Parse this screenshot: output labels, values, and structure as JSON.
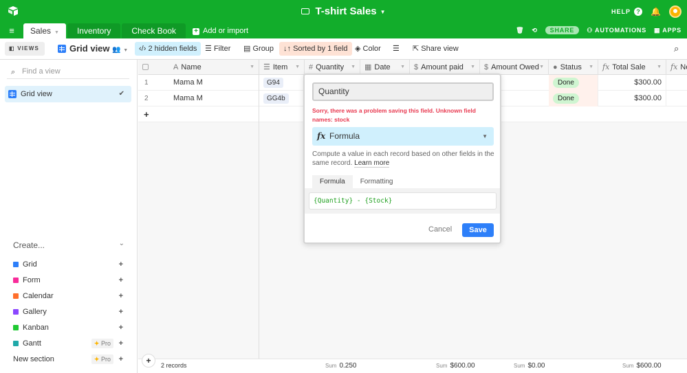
{
  "app": {
    "base_title": "T-shirt Sales",
    "help_label": "HELP",
    "tables": [
      {
        "label": "Sales",
        "active": true
      },
      {
        "label": "Inventory",
        "active": false
      },
      {
        "label": "Check Book",
        "active": false
      }
    ],
    "add_import_label": "Add or import",
    "share_label": "SHARE",
    "automations_label": "AUTOMATIONS",
    "apps_label": "APPS"
  },
  "toolbar": {
    "views_label": "VIEWS",
    "view_name": "Grid view",
    "hidden_fields": "2 hidden fields",
    "filter": "Filter",
    "group": "Group",
    "sort": "Sorted by 1 field",
    "color": "Color",
    "share_view": "Share view"
  },
  "sidebar": {
    "find_placeholder": "Find a view",
    "views": [
      {
        "label": "Grid view",
        "selected": true
      }
    ],
    "create_label": "Create...",
    "create_items": [
      {
        "label": "Grid",
        "color": "#2d7ff9",
        "pro": false
      },
      {
        "label": "Form",
        "color": "#f82b9a",
        "pro": false
      },
      {
        "label": "Calendar",
        "color": "#ff6f2c",
        "pro": false
      },
      {
        "label": "Gallery",
        "color": "#8b46ff",
        "pro": false
      },
      {
        "label": "Kanban",
        "color": "#20c933",
        "pro": false
      },
      {
        "label": "Gantt",
        "color": "#20a9a9",
        "pro": true
      },
      {
        "label": "New section",
        "color": "",
        "pro": true
      }
    ],
    "pro_label": "Pro"
  },
  "grid": {
    "columns": [
      "Name",
      "Item",
      "Quantity",
      "Date",
      "Amount paid",
      "Amount Owed",
      "Status",
      "Total Sale",
      "Ne"
    ],
    "rows": [
      {
        "num": "1",
        "name": "Mama M",
        "item": "G94",
        "status": "Done",
        "total_sale": "$300.00"
      },
      {
        "num": "2",
        "name": "Mama M",
        "item": "GG4b",
        "status": "Done",
        "total_sale": "$300.00"
      }
    ],
    "add_row": "+",
    "footer": {
      "record_count": "2 records",
      "sum_label": "Sum",
      "sum_quantity": "0.250",
      "sum_amount_paid": "$600.00",
      "sum_amount_owed": "$0.00",
      "sum_total_sale": "$600.00"
    }
  },
  "field_editor": {
    "field_name": "Quantity",
    "error": "Sorry, there was a problem saving this field. Unknown field names: stock",
    "field_type": "Formula",
    "description": "Compute a value in each record based on other fields in the same record.",
    "learn_more": "Learn more",
    "tabs": [
      "Formula",
      "Formatting"
    ],
    "formula": "{Quantity} - {Stock}",
    "cancel": "Cancel",
    "save": "Save"
  },
  "colors": {
    "brand_green": "#12ad2b",
    "save_blue": "#2d7ff9",
    "error_red": "#e8384f",
    "done_green": "#cff5d1"
  }
}
